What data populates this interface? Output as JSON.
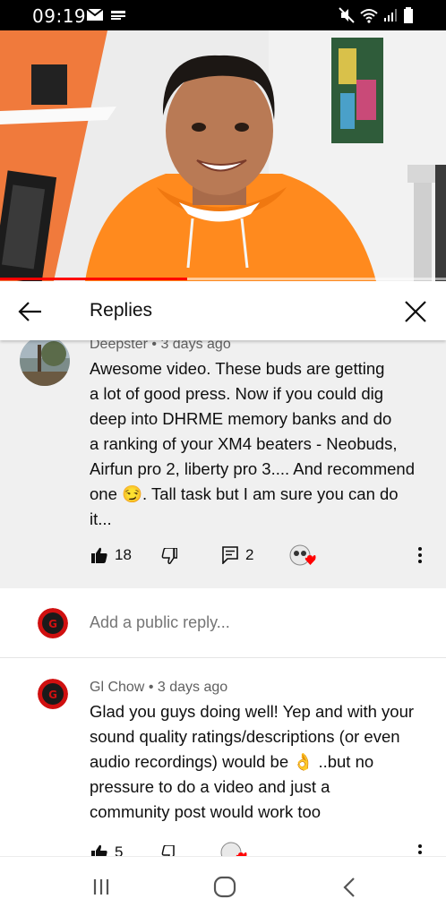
{
  "status_bar": {
    "time": "09:19",
    "left_icons": [
      "mail-icon",
      "news-icon"
    ],
    "right_icons": [
      "mute-icon",
      "wifi-icon",
      "signal-icon",
      "battery-icon"
    ]
  },
  "video": {
    "progress": 0.42
  },
  "header": {
    "title": "Replies"
  },
  "parent_comment": {
    "author": "Deepster",
    "separator": "•",
    "time": "3 days ago",
    "text": "Awesome video. These buds are getting\na lot of good press.  Now if you could dig\ndeep into DHRME memory banks and do\na ranking of your XM4 beaters - Neobuds,\nAirfun pro 2, liberty pro 3.... And recommend\none 😏. Tall task but I am sure you can do\nit...",
    "likes": "18",
    "replies": "2"
  },
  "add_reply": {
    "placeholder": "Add a public reply..."
  },
  "reply": {
    "author": "Gl Chow",
    "separator": "•",
    "time": "3 days ago",
    "text": "Glad you guys doing well! Yep and with your\nsound quality ratings/descriptions (or even\naudio recordings) would be 👌 ..but no\npressure to do a video and just a\ncommunity post would work too",
    "likes": "5"
  },
  "colors": {
    "accent": "#ff0000",
    "hoodie": "#ff8a1e",
    "muted_text": "#606060",
    "comment_bg": "#f0f0f0"
  }
}
